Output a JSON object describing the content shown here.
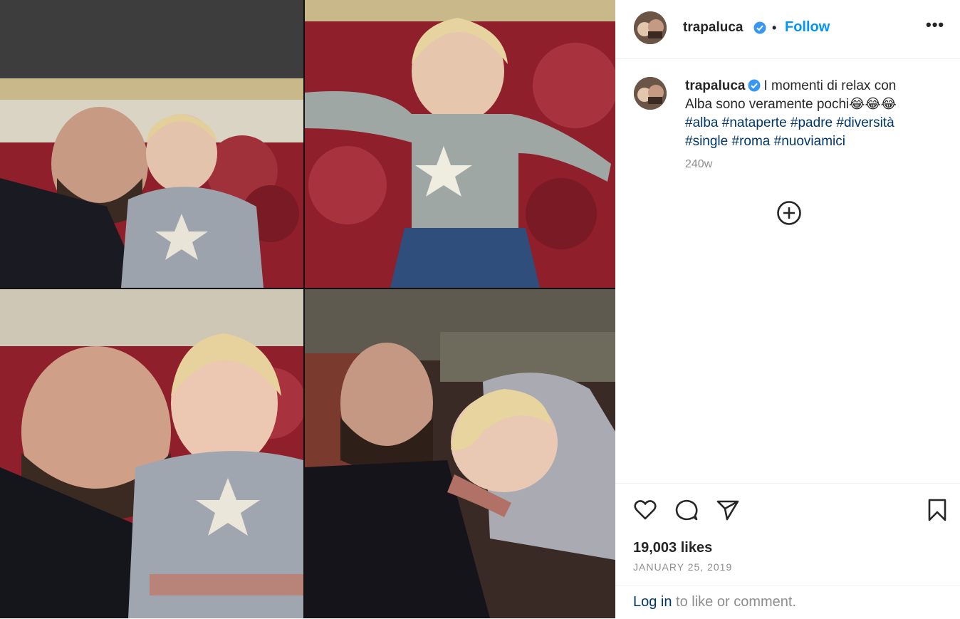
{
  "post": {
    "username": "trapaluca",
    "follow_label": "Follow",
    "separator": "•",
    "more_label": "•••"
  },
  "caption": {
    "username": "trapaluca",
    "text_line1": "I momenti di relax con",
    "text_line2": "Alba sono veramente pochi",
    "emojis": "😂😂😂",
    "hashtags_line1": [
      "#alba",
      "#nataperte",
      "#padre",
      "#diversità"
    ],
    "hashtags_line2": [
      "#single",
      "#roma",
      "#nuoviamici"
    ],
    "time": "240w"
  },
  "engagement": {
    "likes": "19,003 likes",
    "date": "JANUARY 25, 2019"
  },
  "footer": {
    "login_label": "Log in",
    "rest_text": " to like or comment."
  },
  "icons": {
    "verified": "verified-badge-icon",
    "add": "add-circle-icon",
    "like": "heart-icon",
    "comment": "comment-icon",
    "share": "share-icon",
    "save": "bookmark-icon"
  },
  "colors": {
    "accent": "#0095f6",
    "hashtag": "#00376b",
    "secondary": "#8e8e8e"
  }
}
